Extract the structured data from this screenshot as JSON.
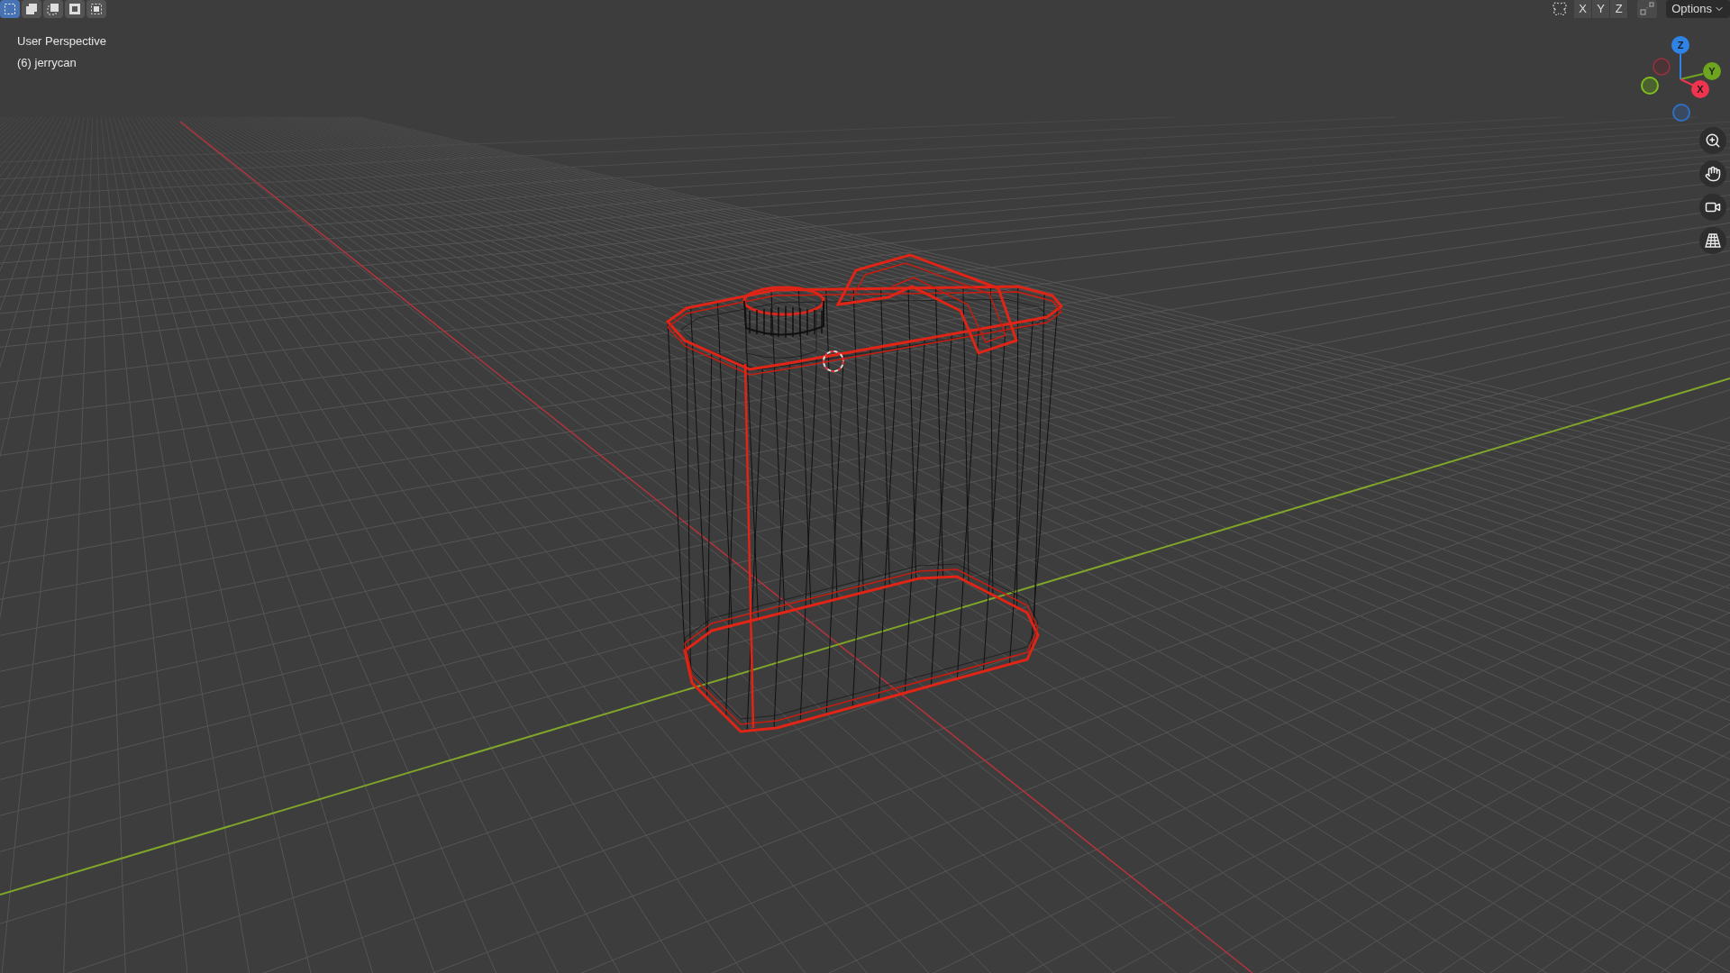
{
  "header_left": {
    "select_modes": [
      {
        "kind": "set",
        "selected": true
      },
      {
        "kind": "extend",
        "selected": false
      },
      {
        "kind": "subtract",
        "selected": false
      },
      {
        "kind": "invert",
        "selected": false
      },
      {
        "kind": "intersect",
        "selected": false
      }
    ]
  },
  "viewport": {
    "view_name": "User Perspective",
    "object_label": "(6) jerrycan"
  },
  "header_right": {
    "axis_buttons": [
      "X",
      "Y",
      "Z"
    ],
    "options_menu": "Options"
  },
  "gizmo": {
    "axes": [
      {
        "kind": "z",
        "label": "Z",
        "color": "#2f83e6"
      },
      {
        "kind": "y",
        "label": "Y",
        "color": "#6ea51e"
      },
      {
        "kind": "x",
        "label": "X",
        "color": "#f0344f"
      }
    ]
  }
}
